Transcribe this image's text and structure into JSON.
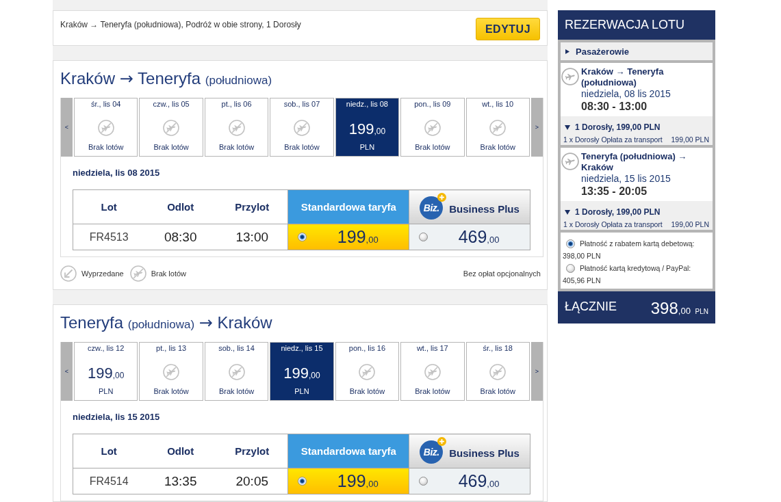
{
  "summary": {
    "text": "Kraków → Teneryfa (południowa), Podróż w obie strony, 1 Dorosły",
    "edit_button": "EDYTUJ"
  },
  "journeys": [
    {
      "title": [
        {
          "text": "Kraków",
          "kind": "main"
        },
        {
          "text": "→",
          "kind": "arrow"
        },
        {
          "text": "Teneryfa",
          "kind": "main"
        },
        {
          "text": "(południowa)",
          "kind": "note"
        }
      ],
      "date_strip": {
        "prev": "<",
        "next": ">",
        "days": [
          {
            "label": "śr., lis 04",
            "kind": "none",
            "status": "Brak lotów",
            "selected": false
          },
          {
            "label": "czw., lis 05",
            "kind": "none",
            "status": "Brak lotów",
            "selected": false
          },
          {
            "label": "pt., lis 06",
            "kind": "none",
            "status": "Brak lotów",
            "selected": false
          },
          {
            "label": "sob., lis 07",
            "kind": "none",
            "status": "Brak lotów",
            "selected": false
          },
          {
            "label": "niedz., lis 08",
            "kind": "fare",
            "amount": "199",
            "decimals": ",00",
            "currency": "PLN",
            "selected": true
          },
          {
            "label": "pon., lis 09",
            "kind": "none",
            "status": "Brak lotów",
            "selected": false
          },
          {
            "label": "wt., lis 10",
            "kind": "none",
            "status": "Brak lotów",
            "selected": false
          }
        ]
      },
      "date_heading": "niedziela, lis 08 2015",
      "table": {
        "columns": [
          "Lot",
          "Odlot",
          "Przylot"
        ],
        "fares": [
          {
            "kind": "standard",
            "name": "Standardowa taryfa"
          },
          {
            "kind": "business",
            "name": "Business Plus",
            "logo_text": "Biz."
          }
        ],
        "rows": [
          {
            "flight": "FR4513",
            "departure": "08:30",
            "arrival": "13:00",
            "prices": [
              {
                "amount": "199",
                "decimals": ",00",
                "selected": true
              },
              {
                "amount": "469",
                "decimals": ",00",
                "selected": false
              }
            ]
          }
        ]
      },
      "legend": [
        {
          "kind": "sold_out",
          "label": "Wyprzedane"
        },
        {
          "kind": "no_flights",
          "label": "Brak lotów"
        }
      ],
      "note": "Bez opłat opcjonalnych"
    },
    {
      "title": [
        {
          "text": "Teneryfa",
          "kind": "main"
        },
        {
          "text": "(południowa)",
          "kind": "note"
        },
        {
          "text": "→",
          "kind": "arrow"
        },
        {
          "text": "Kraków",
          "kind": "main"
        }
      ],
      "date_strip": {
        "prev": "<",
        "next": ">",
        "days": [
          {
            "label": "czw., lis 12",
            "kind": "fare",
            "amount": "199",
            "decimals": ",00",
            "currency": "PLN",
            "selected": false
          },
          {
            "label": "pt., lis 13",
            "kind": "none",
            "status": "Brak lotów",
            "selected": false
          },
          {
            "label": "sob., lis 14",
            "kind": "none",
            "status": "Brak lotów",
            "selected": false
          },
          {
            "label": "niedz., lis 15",
            "kind": "fare",
            "amount": "199",
            "decimals": ",00",
            "currency": "PLN",
            "selected": true
          },
          {
            "label": "pon., lis 16",
            "kind": "none",
            "status": "Brak lotów",
            "selected": false
          },
          {
            "label": "wt., lis 17",
            "kind": "none",
            "status": "Brak lotów",
            "selected": false
          },
          {
            "label": "śr., lis 18",
            "kind": "none",
            "status": "Brak lotów",
            "selected": false
          }
        ]
      },
      "date_heading": "niedziela, lis 15 2015",
      "table": {
        "columns": [
          "Lot",
          "Odlot",
          "Przylot"
        ],
        "fares": [
          {
            "kind": "standard",
            "name": "Standardowa taryfa"
          },
          {
            "kind": "business",
            "name": "Business Plus",
            "logo_text": "Biz."
          }
        ],
        "rows": [
          {
            "flight": "FR4514",
            "departure": "13:35",
            "arrival": "20:05",
            "prices": [
              {
                "amount": "199",
                "decimals": ",00",
                "selected": true
              },
              {
                "amount": "469",
                "decimals": ",00",
                "selected": false
              }
            ]
          }
        ]
      }
    }
  ],
  "sidebar": {
    "title": "REZERWACJA LOTU",
    "passengers": {
      "label": "Pasażerowie",
      "expanded": false
    },
    "flights": [
      {
        "route": "Kraków → Teneryfa (południowa)",
        "date": "niedziela, 08 lis 2015",
        "times": "08:30 - 13:00",
        "fare": {
          "summary": "1 Dorosły, 199,00 PLN",
          "expanded": true,
          "lines": [
            {
              "label": "1 x Dorosły Opłata za transport",
              "amount": "199,00 PLN"
            }
          ]
        }
      },
      {
        "route": "Teneryfa (południowa) → Kraków",
        "date": "niedziela, 15 lis 2015",
        "times": "13:35 - 20:05",
        "fare": {
          "summary": "1 Dorosły, 199,00 PLN",
          "expanded": true,
          "lines": [
            {
              "label": "1 x Dorosły Opłata za transport",
              "amount": "199,00 PLN"
            }
          ]
        }
      }
    ],
    "payment_options": [
      {
        "label": "Płatność z rabatem kartą debetową:",
        "amount": "398,00 PLN",
        "selected": true
      },
      {
        "label": "Płatność kartą kredytową / PayPal:",
        "amount": "405,96 PLN",
        "selected": false
      }
    ],
    "total": {
      "label": "ŁĄCZNIE",
      "amount": "398",
      "decimals": ",00",
      "currency": "PLN"
    }
  }
}
